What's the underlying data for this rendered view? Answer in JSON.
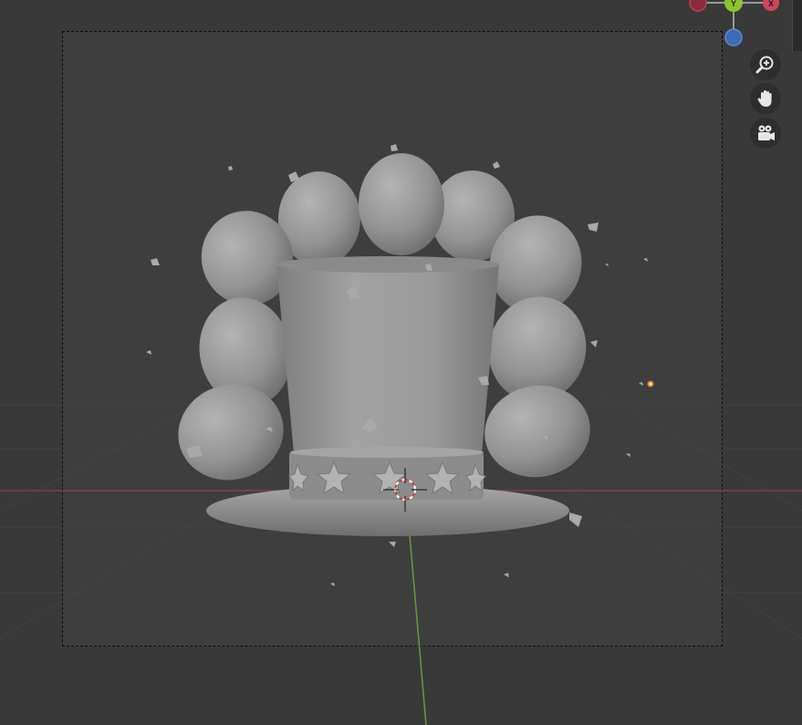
{
  "viewport": {
    "background": "#393939",
    "frame_fill": "#434343",
    "x_axis_color": "#b5474c",
    "y_axis_color": "#6a9a3a",
    "model_color": "#9b9b9b"
  },
  "gizmo": {
    "x_label": "X",
    "y_label": "Y",
    "x_color": "#d0465a",
    "y_color": "#8ac52e",
    "z_color": "#3d6bb3"
  },
  "nav_buttons": [
    {
      "icon": "zoom-icon"
    },
    {
      "icon": "pan-hand-icon"
    },
    {
      "icon": "camera-view-icon"
    }
  ],
  "scene_objects": [
    "top-hat",
    "balloons",
    "confetti",
    "3d-cursor",
    "light"
  ]
}
